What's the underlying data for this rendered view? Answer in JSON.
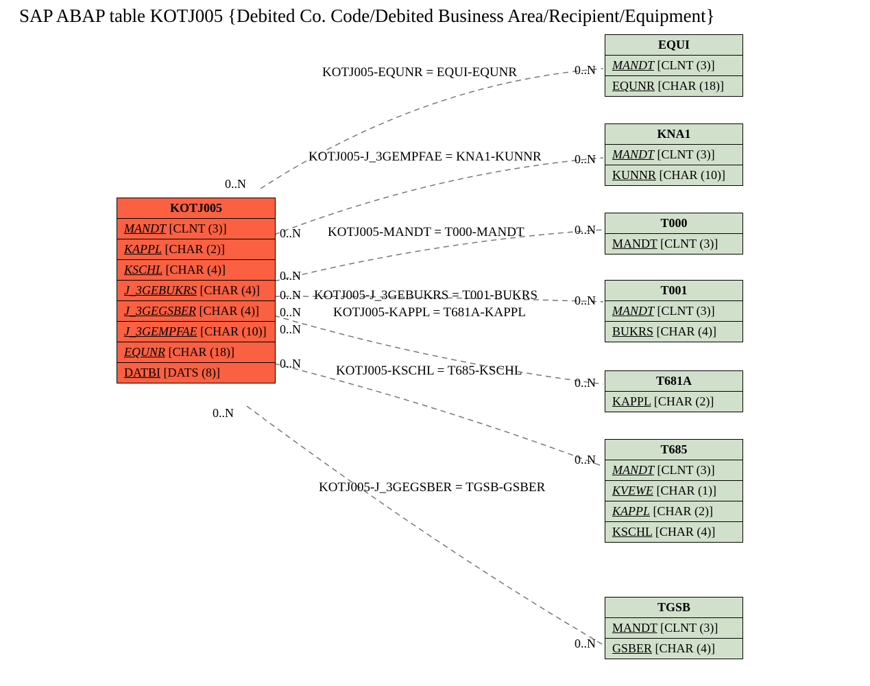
{
  "title": "SAP ABAP table KOTJ005 {Debited Co. Code/Debited Business Area/Recipient/Equipment}",
  "main": {
    "name": "KOTJ005",
    "fields": [
      {
        "name": "MANDT",
        "type": "[CLNT (3)]",
        "key": true
      },
      {
        "name": "KAPPL",
        "type": "[CHAR (2)]",
        "key": true
      },
      {
        "name": "KSCHL",
        "type": "[CHAR (4)]",
        "key": true
      },
      {
        "name": "J_3GEBUKRS",
        "type": "[CHAR (4)]",
        "key": true
      },
      {
        "name": "J_3GEGSBER",
        "type": "[CHAR (4)]",
        "key": true
      },
      {
        "name": "J_3GEMPFAE",
        "type": "[CHAR (10)]",
        "key": true
      },
      {
        "name": "EQUNR",
        "type": "[CHAR (18)]",
        "key": true
      },
      {
        "name": "DATBI",
        "type": "[DATS (8)]",
        "key": false
      }
    ]
  },
  "refs": [
    {
      "name": "EQUI",
      "fields": [
        {
          "name": "MANDT",
          "type": "[CLNT (3)]",
          "key": true
        },
        {
          "name": "EQUNR",
          "type": "[CHAR (18)]",
          "key": false
        }
      ]
    },
    {
      "name": "KNA1",
      "fields": [
        {
          "name": "MANDT",
          "type": "[CLNT (3)]",
          "key": true
        },
        {
          "name": "KUNNR",
          "type": "[CHAR (10)]",
          "key": false
        }
      ]
    },
    {
      "name": "T000",
      "fields": [
        {
          "name": "MANDT",
          "type": "[CLNT (3)]",
          "key": false
        }
      ]
    },
    {
      "name": "T001",
      "fields": [
        {
          "name": "MANDT",
          "type": "[CLNT (3)]",
          "key": true
        },
        {
          "name": "BUKRS",
          "type": "[CHAR (4)]",
          "key": false
        }
      ]
    },
    {
      "name": "T681A",
      "fields": [
        {
          "name": "KAPPL",
          "type": "[CHAR (2)]",
          "key": false
        }
      ]
    },
    {
      "name": "T685",
      "fields": [
        {
          "name": "MANDT",
          "type": "[CLNT (3)]",
          "key": true
        },
        {
          "name": "KVEWE",
          "type": "[CHAR (1)]",
          "key": true
        },
        {
          "name": "KAPPL",
          "type": "[CHAR (2)]",
          "key": true
        },
        {
          "name": "KSCHL",
          "type": "[CHAR (4)]",
          "key": false
        }
      ]
    },
    {
      "name": "TGSB",
      "fields": [
        {
          "name": "MANDT",
          "type": "[CLNT (3)]",
          "key": false
        },
        {
          "name": "GSBER",
          "type": "[CHAR (4)]",
          "key": false
        }
      ]
    }
  ],
  "relations": [
    {
      "label": "KOTJ005-EQUNR = EQUI-EQUNR",
      "lcard": "0..N",
      "rcard": "0..N"
    },
    {
      "label": "KOTJ005-J_3GEMPFAE = KNA1-KUNNR",
      "lcard": "0..N",
      "rcard": "0..N"
    },
    {
      "label": "KOTJ005-MANDT = T000-MANDT",
      "lcard": "0..N",
      "rcard": "0..N"
    },
    {
      "label": "KOTJ005-J_3GEBUKRS = T001-BUKRS",
      "lcard": "0..N",
      "rcard": "0..N"
    },
    {
      "label": "KOTJ005-KAPPL = T681A-KAPPL",
      "lcard": "0..N",
      "rcard": "0..N"
    },
    {
      "label": "KOTJ005-KSCHL = T685-KSCHL",
      "lcard": "0..N",
      "rcard": "0..N"
    },
    {
      "label": "KOTJ005-J_3GEGSBER = TGSB-GSBER",
      "lcard": "0..N",
      "rcard": "0..N"
    }
  ]
}
